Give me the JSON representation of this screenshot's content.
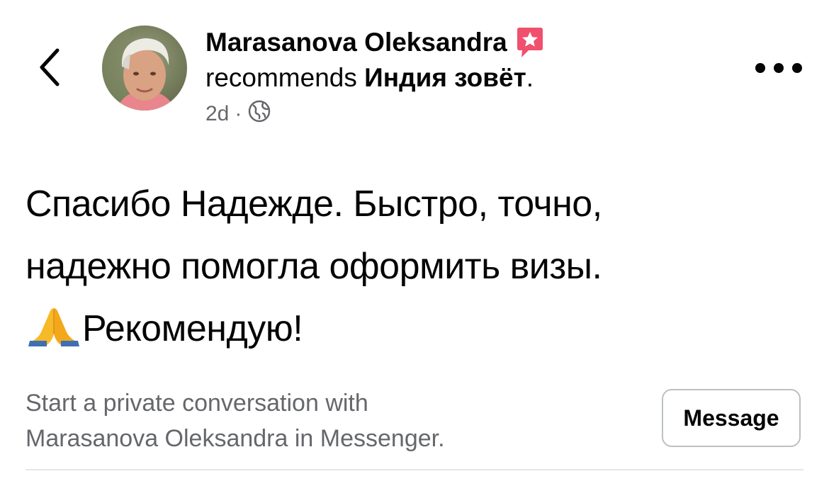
{
  "nav": {
    "back_icon": "chevron-left-icon",
    "more_icon": "more-horizontal-icon"
  },
  "post": {
    "author_name": "Marasanova Oleksandra",
    "badge_icon": "recommendation-star-badge-icon",
    "action_text": "recommends",
    "page_name": "Индия зовёт",
    "page_name_suffix": ".",
    "time": "2d",
    "separator": "·",
    "privacy_icon": "globe-icon",
    "body_lines": [
      "Спасибо Надежде. Быстро, точно,",
      "надежно помогла оформить визы."
    ],
    "body_emoji": "folded-hands-emoji",
    "body_last_line": "Рекомендую!"
  },
  "messenger_cta": {
    "line_1": "Start a private conversation with",
    "line_2": "Marasanova Oleksandra in Messenger.",
    "button_label": "Message"
  },
  "colors": {
    "primary_text": "#050505",
    "secondary_text": "#65676b",
    "badge": "#f0506e",
    "divider": "#e4e6eb",
    "button_border": "#bcc0c4"
  }
}
